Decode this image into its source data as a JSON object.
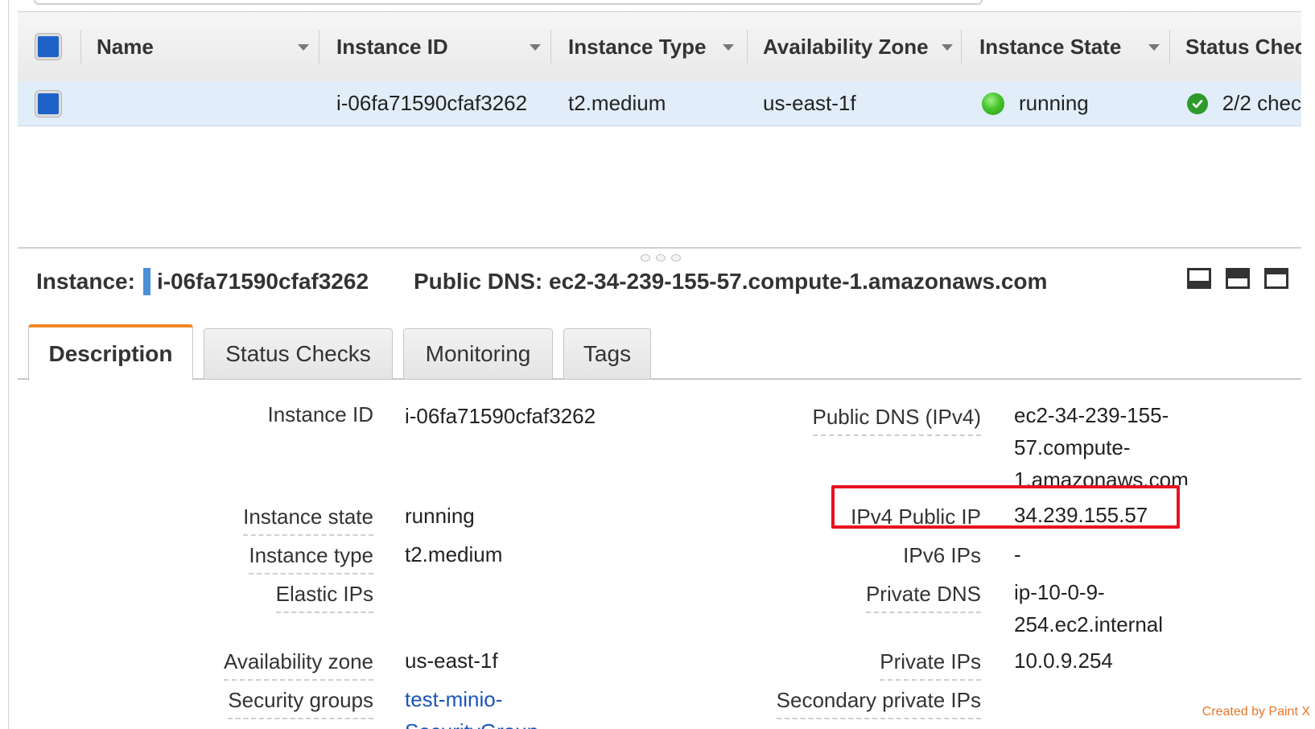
{
  "grid": {
    "columns": [
      {
        "label": "Name"
      },
      {
        "label": "Instance ID"
      },
      {
        "label": "Instance Type"
      },
      {
        "label": "Availability Zone"
      },
      {
        "label": "Instance State"
      },
      {
        "label": "Status Chec"
      }
    ],
    "row": {
      "name": "",
      "instance_id": "i-06fa71590cfaf3262",
      "instance_type": "t2.medium",
      "availability_zone": "us-east-1f",
      "instance_state": "running",
      "status_checks": "2/2 chec"
    }
  },
  "detail": {
    "instance_label": "Instance:",
    "instance_id": "i-06fa71590cfaf3262",
    "public_dns_label": "Public DNS:",
    "public_dns": "ec2-34-239-155-57.compute-1.amazonaws.com"
  },
  "tabs": [
    "Description",
    "Status Checks",
    "Monitoring",
    "Tags"
  ],
  "description": {
    "left": [
      {
        "label": "Instance ID",
        "value": "i-06fa71590cfaf3262"
      },
      {
        "label": "Instance state",
        "value": "running"
      },
      {
        "label": "Instance type",
        "value": "t2.medium"
      },
      {
        "label": "Elastic IPs",
        "value": ""
      },
      {
        "label": "Availability zone",
        "value": "us-east-1f"
      },
      {
        "label": "Security groups",
        "value_line1": "test-minio-",
        "value_line2": "SecurityGroup"
      }
    ],
    "right": [
      {
        "label": "Public DNS (IPv4)",
        "value_line1": "ec2-34-239-155-",
        "value_line2": "57.compute-",
        "value_line3": "1.amazonaws.com"
      },
      {
        "label": "IPv4 Public IP",
        "value": "34.239.155.57"
      },
      {
        "label": "IPv6 IPs",
        "value": "-"
      },
      {
        "label": "Private DNS",
        "value_line1": "ip-10-0-9-",
        "value_line2": "254.ec2.internal"
      },
      {
        "label": "Private IPs",
        "value": "10.0.9.254"
      },
      {
        "label": "Secondary private IPs",
        "value": ""
      }
    ]
  },
  "watermark": "Created by Paint X",
  "colors": {
    "accent_tab": "#f08a24",
    "checkbox": "#1f62c7",
    "selected_row": "#e1edf9",
    "running": "#45c42a",
    "link": "#1a56b8",
    "highlight": "#e8121f"
  }
}
